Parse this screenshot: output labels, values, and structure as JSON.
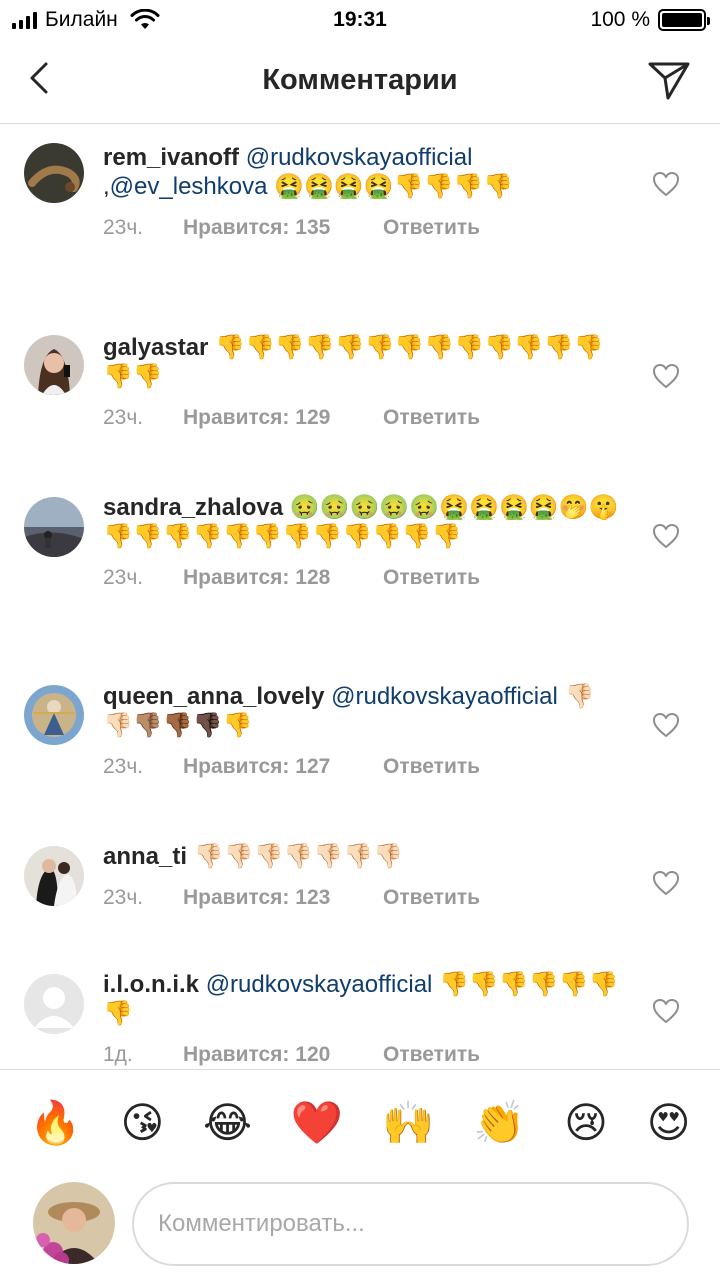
{
  "status": {
    "carrier": "Билайн",
    "time": "19:31",
    "battery": "100 %",
    "battery_level": 1.0
  },
  "header": {
    "title": "Комментарии",
    "back_icon": "chevron-left-icon",
    "send_icon": "paper-plane-icon"
  },
  "comments": [
    {
      "username": "rem_ivanoff",
      "parts": [
        {
          "t": "mention",
          "v": "@rudkovskayaofficial"
        },
        {
          "t": "text",
          "v": " ,"
        },
        {
          "t": "mention",
          "v": "@ev_leshkova"
        },
        {
          "t": "text",
          "v": " 🤮🤮🤮🤮👎👎👎👎"
        }
      ],
      "time": "23ч.",
      "likes": "Нравится: 135",
      "reply": "Ответить"
    },
    {
      "username": "galyastar",
      "parts": [
        {
          "t": "text",
          "v": "👎👎👎👎👎👎👎👎👎👎👎👎👎👎👎"
        }
      ],
      "time": "23ч.",
      "likes": "Нравится: 129",
      "reply": "Ответить"
    },
    {
      "username": "sandra_zhalova",
      "parts": [
        {
          "t": "text",
          "v": "🤢🤢🤢🤢🤢🤮🤮🤮🤮🤭🤫👎👎👎👎👎👎👎👎👎👎👎👎"
        }
      ],
      "time": "23ч.",
      "likes": "Нравится: 128",
      "reply": "Ответить"
    },
    {
      "username": "queen_anna_lovely",
      "parts": [
        {
          "t": "mention",
          "v": "@rudkovskayaofficial"
        },
        {
          "t": "text",
          "v": " 👎🏻👎🏻👎🏽👎🏾👎🏿👎"
        }
      ],
      "time": "23ч.",
      "likes": "Нравится: 127",
      "reply": "Ответить"
    },
    {
      "username": "anna_ti",
      "parts": [
        {
          "t": "text",
          "v": "👎🏻👎🏻👎🏻👎🏻👎🏻👎🏻👎🏻"
        }
      ],
      "time": "23ч.",
      "likes": "Нравится: 123",
      "reply": "Ответить"
    },
    {
      "username": "i.l.o.n.i.k",
      "parts": [
        {
          "t": "mention",
          "v": "@rudkovskayaofficial"
        },
        {
          "t": "text",
          "v": " 👎👎👎👎👎👎👎"
        }
      ],
      "time": "1д.",
      "likes": "Нравится: 120",
      "reply": "Ответить"
    }
  ],
  "reactions": [
    "🔥",
    "😘",
    "😂",
    "❤️",
    "🙌",
    "👏",
    "😢",
    "😍"
  ],
  "composer": {
    "placeholder": "Комментировать..."
  }
}
